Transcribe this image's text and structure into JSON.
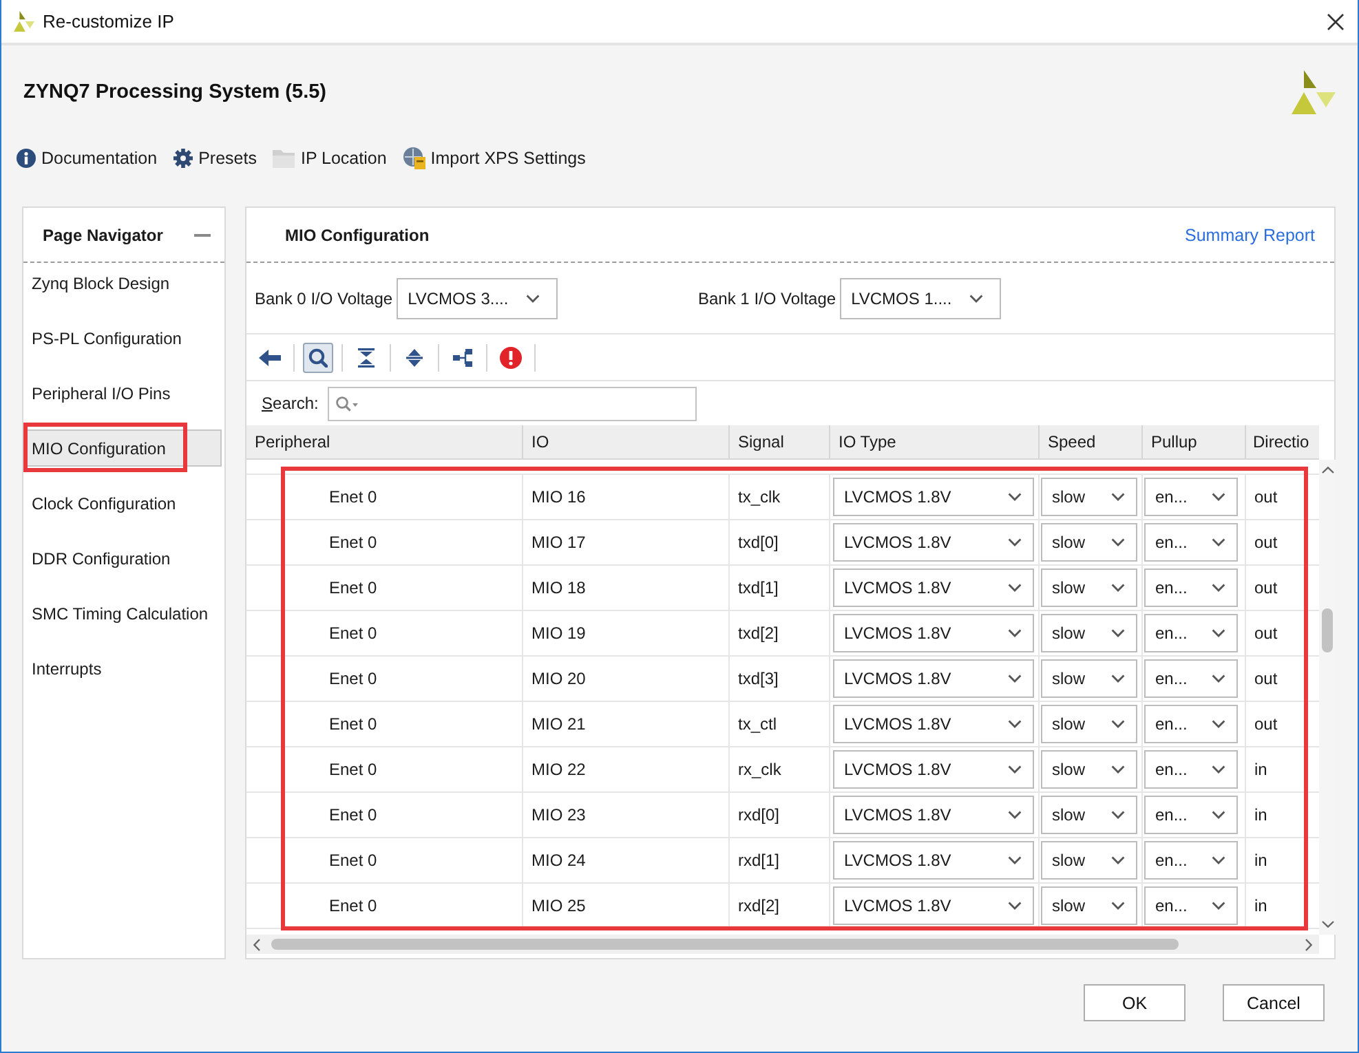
{
  "window": {
    "title": "Re-customize IP"
  },
  "header": {
    "title": "ZYNQ7 Processing System (5.5)"
  },
  "toolbar": [
    {
      "kind": "info",
      "label": "Documentation"
    },
    {
      "kind": "gear",
      "label": "Presets"
    },
    {
      "kind": "folder",
      "label": "IP Location"
    },
    {
      "kind": "import",
      "label": "Import XPS Settings"
    }
  ],
  "page_navigator": {
    "title": "Page Navigator",
    "items": [
      {
        "label": "Zynq Block Design",
        "selected": false,
        "highlighted": false
      },
      {
        "label": "PS-PL Configuration",
        "selected": false,
        "highlighted": false
      },
      {
        "label": "Peripheral I/O Pins",
        "selected": false,
        "highlighted": false
      },
      {
        "label": "MIO Configuration",
        "selected": true,
        "highlighted": true
      },
      {
        "label": "Clock Configuration",
        "selected": false,
        "highlighted": false
      },
      {
        "label": "DDR Configuration",
        "selected": false,
        "highlighted": false
      },
      {
        "label": "SMC Timing Calculation",
        "selected": false,
        "highlighted": false
      },
      {
        "label": "Interrupts",
        "selected": false,
        "highlighted": false
      }
    ]
  },
  "page": {
    "title": "MIO Configuration",
    "summary_link": "Summary Report",
    "bank_voltages": [
      {
        "label": "Bank 0 I/O Voltage",
        "value": "LVCMOS 3...."
      },
      {
        "label": "Bank 1 I/O Voltage",
        "value": "LVCMOS 1...."
      }
    ],
    "tools": [
      {
        "kind": "back",
        "pressed": false
      },
      {
        "kind": "search",
        "pressed": true
      },
      {
        "kind": "collapse",
        "pressed": false
      },
      {
        "kind": "expand",
        "pressed": false
      },
      {
        "kind": "hierarchy",
        "pressed": false
      },
      {
        "kind": "error",
        "pressed": false
      }
    ],
    "search": {
      "label": "Search:"
    }
  },
  "table": {
    "highlighted": true,
    "columns": [
      "Peripheral",
      "IO",
      "Signal",
      "IO Type",
      "Speed",
      "Pullup",
      "Directio"
    ],
    "rows": [
      {
        "peripheral": "Enet 0",
        "io": "MIO 16",
        "signal": "tx_clk",
        "io_type": "LVCMOS 1.8V",
        "speed": "slow",
        "pullup": "en...",
        "direction": "out"
      },
      {
        "peripheral": "Enet 0",
        "io": "MIO 17",
        "signal": "txd[0]",
        "io_type": "LVCMOS 1.8V",
        "speed": "slow",
        "pullup": "en...",
        "direction": "out"
      },
      {
        "peripheral": "Enet 0",
        "io": "MIO 18",
        "signal": "txd[1]",
        "io_type": "LVCMOS 1.8V",
        "speed": "slow",
        "pullup": "en...",
        "direction": "out"
      },
      {
        "peripheral": "Enet 0",
        "io": "MIO 19",
        "signal": "txd[2]",
        "io_type": "LVCMOS 1.8V",
        "speed": "slow",
        "pullup": "en...",
        "direction": "out"
      },
      {
        "peripheral": "Enet 0",
        "io": "MIO 20",
        "signal": "txd[3]",
        "io_type": "LVCMOS 1.8V",
        "speed": "slow",
        "pullup": "en...",
        "direction": "out"
      },
      {
        "peripheral": "Enet 0",
        "io": "MIO 21",
        "signal": "tx_ctl",
        "io_type": "LVCMOS 1.8V",
        "speed": "slow",
        "pullup": "en...",
        "direction": "out"
      },
      {
        "peripheral": "Enet 0",
        "io": "MIO 22",
        "signal": "rx_clk",
        "io_type": "LVCMOS 1.8V",
        "speed": "slow",
        "pullup": "en...",
        "direction": "in"
      },
      {
        "peripheral": "Enet 0",
        "io": "MIO 23",
        "signal": "rxd[0]",
        "io_type": "LVCMOS 1.8V",
        "speed": "slow",
        "pullup": "en...",
        "direction": "in"
      },
      {
        "peripheral": "Enet 0",
        "io": "MIO 24",
        "signal": "rxd[1]",
        "io_type": "LVCMOS 1.8V",
        "speed": "slow",
        "pullup": "en...",
        "direction": "in"
      },
      {
        "peripheral": "Enet 0",
        "io": "MIO 25",
        "signal": "rxd[2]",
        "io_type": "LVCMOS 1.8V",
        "speed": "slow",
        "pullup": "en...",
        "direction": "in"
      }
    ]
  },
  "buttons": [
    "OK",
    "Cancel"
  ]
}
